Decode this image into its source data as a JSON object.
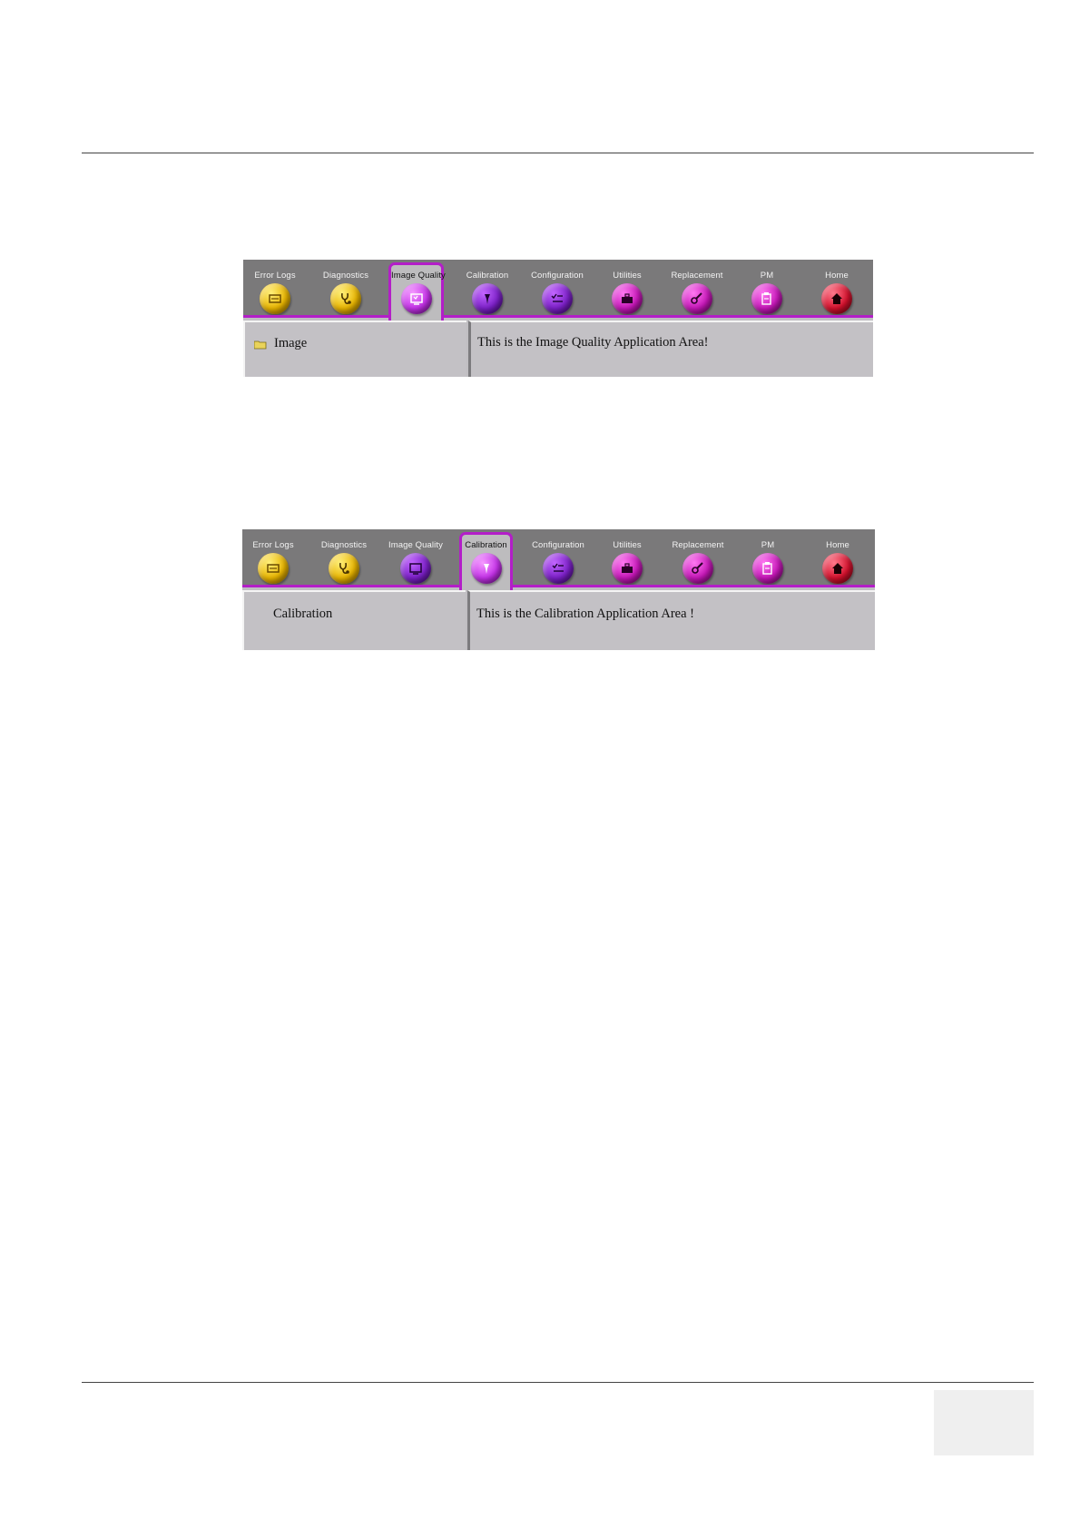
{
  "toolbar_items": [
    {
      "label": "Error Logs",
      "icon": "error-logs-icon",
      "color": "#e8b400"
    },
    {
      "label": "Diagnostics",
      "icon": "stethoscope-icon",
      "color": "#e8b400"
    },
    {
      "label": "Image Quality",
      "icon": "monitor-icon",
      "color": "#7b1fc7"
    },
    {
      "label": "Calibration",
      "icon": "pin-icon",
      "color": "#7b1fc7"
    },
    {
      "label": "Configuration",
      "icon": "checklist-icon",
      "color": "#7b1fc7"
    },
    {
      "label": "Utilities",
      "icon": "toolbox-icon",
      "color": "#c616b8"
    },
    {
      "label": "Replacement",
      "icon": "wrench-icon",
      "color": "#c616b8"
    },
    {
      "label": "PM",
      "icon": "clipboard-icon",
      "color": "#c616b8"
    },
    {
      "label": "Home",
      "icon": "home-icon",
      "color": "#d3102c"
    }
  ],
  "screenshot_image_quality": {
    "toolbar": {
      "error_logs": "Error Logs",
      "diagnostics": "Diagnostics",
      "image_quality": "Image Quality",
      "calibration": "Calibration",
      "configuration": "Configuration",
      "utilities": "Utilities",
      "replacement": "Replacement",
      "pm": "PM",
      "home": "Home"
    },
    "active_tab": "Image Quality",
    "tree_item": "Image",
    "application_text": "This is the Image Quality Application Area!"
  },
  "screenshot_calibration": {
    "toolbar": {
      "error_logs": "Error Logs",
      "diagnostics": "Diagnostics",
      "image_quality": "Image Quality",
      "calibration": "Calibration",
      "configuration": "Configuration",
      "utilities": "Utilities",
      "replacement": "Replacement",
      "pm": "PM",
      "home": "Home"
    },
    "active_tab": "Calibration",
    "tree_item": "Calibration",
    "application_text": "This is the Calibration Application Area !"
  },
  "colors": {
    "accent": "#b31ec8",
    "toolbar_background": "#7a797a",
    "panel_background": "#c3c1c5"
  }
}
